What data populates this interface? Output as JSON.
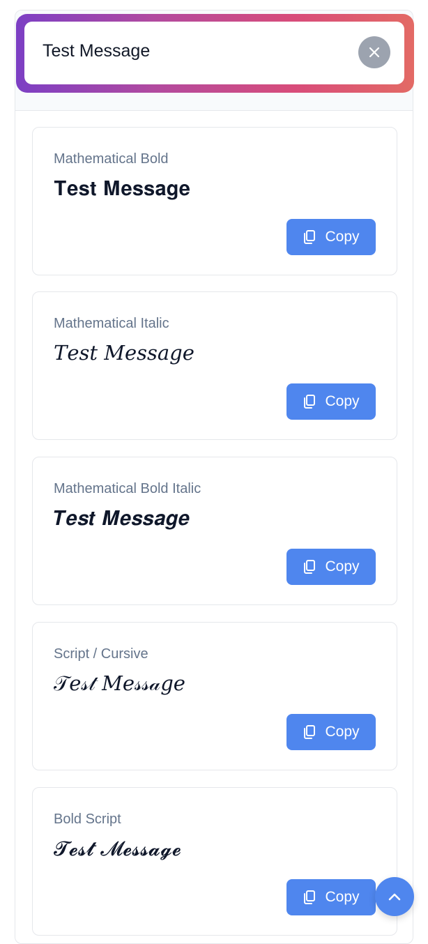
{
  "search": {
    "value": "Test Message",
    "clear_icon": "close-icon"
  },
  "styles": [
    {
      "label": "Mathematical Bold",
      "preview": "𝐓𝐞𝐬𝐭 𝐌𝐞𝐬𝐬𝐚𝐠𝐞",
      "copy_label": "Copy"
    },
    {
      "label": "Mathematical Italic",
      "preview": "𝑇𝑒𝑠𝑡 𝑀𝑒𝑠𝑠𝑎𝑔𝑒",
      "copy_label": "Copy"
    },
    {
      "label": "Mathematical Bold Italic",
      "preview": "𝑻𝒆𝒔𝒕 𝑴𝒆𝒔𝒔𝒂𝒈𝒆",
      "copy_label": "Copy"
    },
    {
      "label": "Script / Cursive",
      "preview": "𝒯𝑒𝓈𝓉 𝑀𝑒𝓈𝓈𝒶𝑔𝑒",
      "copy_label": "Copy"
    },
    {
      "label": "Bold Script",
      "preview": "𝓣𝓮𝓼𝓽 𝓜𝓮𝓼𝓼𝓪𝓰𝓮",
      "copy_label": "Copy"
    }
  ],
  "icons": {
    "copy": "copy-icon",
    "scroll_top": "chevron-up-icon"
  },
  "colors": {
    "accent": "#4f86ee",
    "gradient": [
      "#7c3fc4",
      "#d84c7a",
      "#e36a65"
    ],
    "label": "#64748b",
    "text": "#0f172a"
  }
}
